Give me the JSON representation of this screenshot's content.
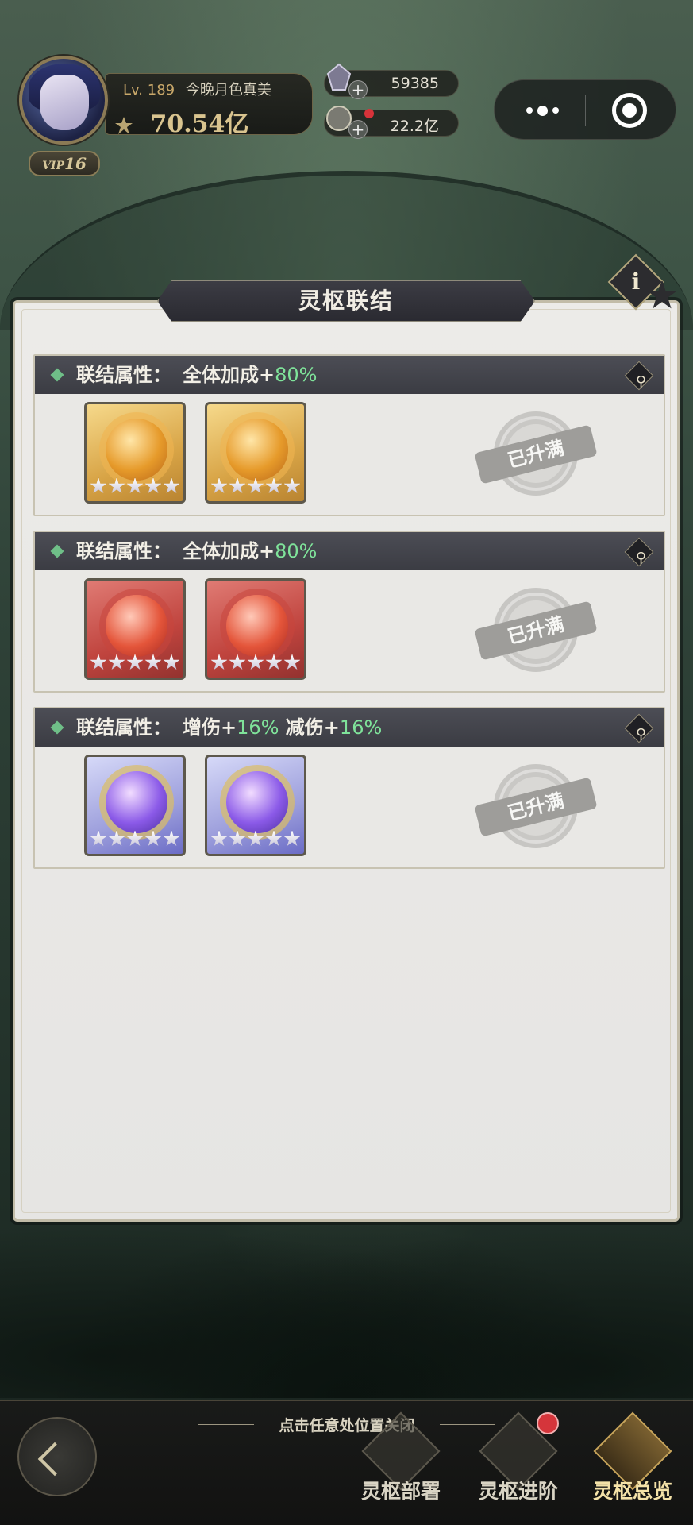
{
  "header": {
    "level_label": "Lv.",
    "level_value": "189",
    "player_name": "今晚月色真美",
    "power_value": "70.54亿",
    "vip_prefix": "VIP",
    "vip_level": "16",
    "currency": [
      {
        "icon": "crystal-icon",
        "value": "59385"
      },
      {
        "icon": "coin-icon",
        "value": "22.2亿"
      }
    ]
  },
  "panel": {
    "title": "灵枢联结",
    "sets": [
      {
        "prefix": "联结属性：",
        "parts": [
          {
            "text": "全体加成+"
          },
          {
            "value": "80%"
          }
        ],
        "relics": [
          "gold",
          "gold"
        ],
        "stars": 5,
        "status": "已升满"
      },
      {
        "prefix": "联结属性：",
        "parts": [
          {
            "text": "全体加成+"
          },
          {
            "value": "80%"
          }
        ],
        "relics": [
          "red",
          "red"
        ],
        "stars": 5,
        "status": "已升满"
      },
      {
        "prefix": "联结属性：",
        "parts": [
          {
            "text": "增伤+"
          },
          {
            "value": "16%"
          },
          {
            "text": " 减伤+"
          },
          {
            "value": "16%"
          }
        ],
        "relics": [
          "purple",
          "purple"
        ],
        "stars": 5,
        "status": "已升满"
      }
    ]
  },
  "footer": {
    "close_hint": "点击任意处位置关闭",
    "nav": [
      {
        "label": "灵枢部署",
        "active": false,
        "badge": false
      },
      {
        "label": "灵枢进阶",
        "active": false,
        "badge": true
      },
      {
        "label": "灵枢总览",
        "active": true,
        "badge": false
      }
    ]
  },
  "colors": {
    "highlight_green": "#7fe39a",
    "header_bar": "#3b3c43",
    "panel_bg": "#e9e8e5"
  }
}
